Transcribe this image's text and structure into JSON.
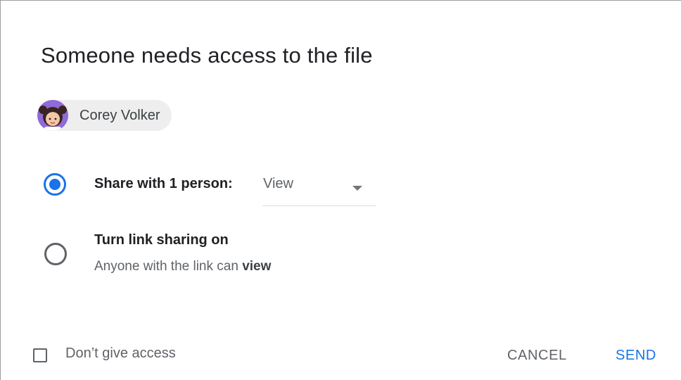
{
  "dialog": {
    "title": "Someone needs access to the file"
  },
  "requester": {
    "name": "Corey Volker",
    "avatar_icon": "person-avatar-icon"
  },
  "options": {
    "share": {
      "label": "Share with 1 person:",
      "selected": true,
      "permission": "View"
    },
    "link": {
      "title": "Turn link sharing on",
      "subtitle_prefix": "Anyone with the link can ",
      "subtitle_emphasis": "view",
      "selected": false
    }
  },
  "footer": {
    "dont_give_access_label": "Don’t give access",
    "dont_give_access_checked": false,
    "cancel_label": "CANCEL",
    "send_label": "SEND"
  },
  "colors": {
    "accent": "#1a73e8",
    "chip_background": "#eeeeee",
    "secondary_text": "#5f6368"
  }
}
